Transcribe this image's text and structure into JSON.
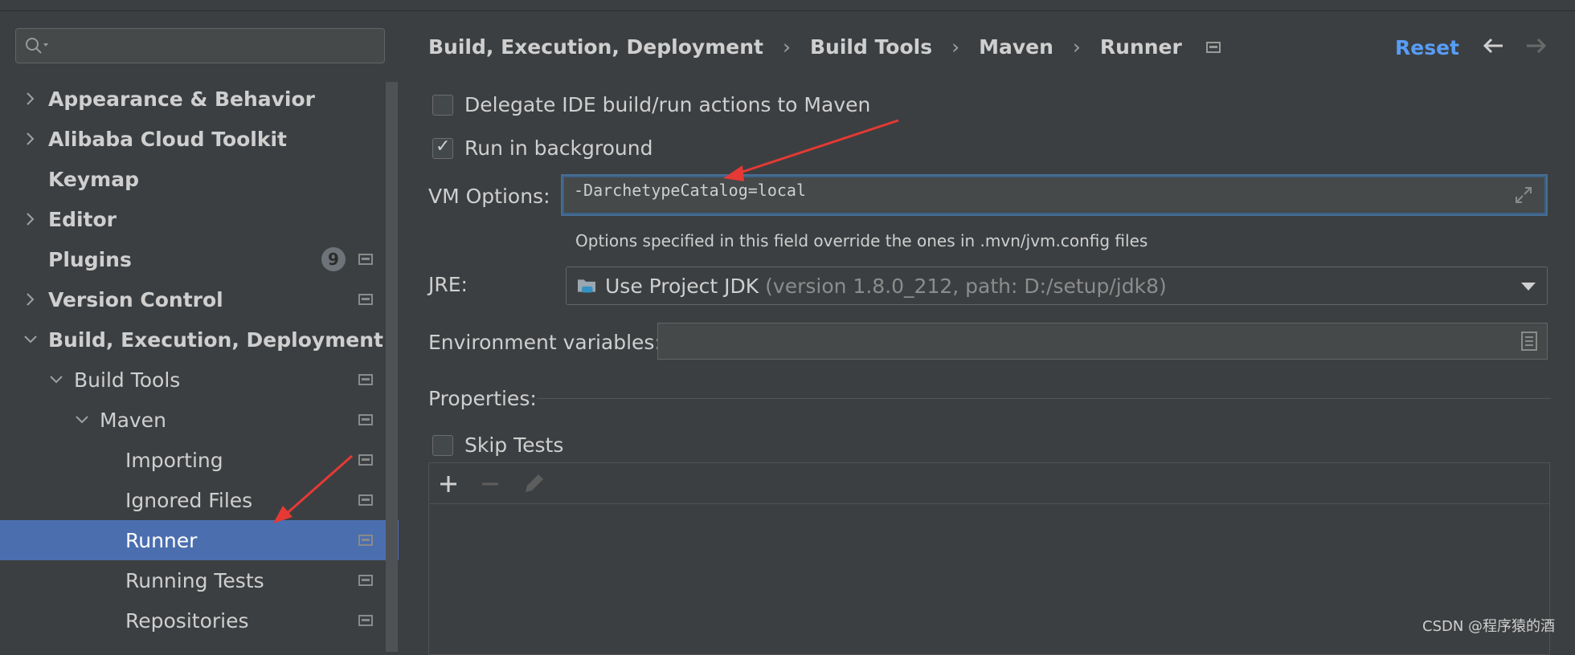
{
  "sidebar": {
    "search": {
      "placeholder": "",
      "value": ""
    },
    "items": [
      {
        "label": "Appearance & Behavior",
        "expand": "collapsed"
      },
      {
        "label": "Alibaba Cloud Toolkit",
        "expand": "collapsed"
      },
      {
        "label": "Keymap",
        "expand": "none"
      },
      {
        "label": "Editor",
        "expand": "collapsed"
      },
      {
        "label": "Plugins",
        "expand": "none",
        "badge": "9"
      },
      {
        "label": "Version Control",
        "expand": "collapsed"
      },
      {
        "label": "Build, Execution, Deployment",
        "expand": "expanded"
      },
      {
        "label": "Build Tools",
        "expand": "expanded"
      },
      {
        "label": "Maven",
        "expand": "expanded"
      },
      {
        "label": "Importing"
      },
      {
        "label": "Ignored Files"
      },
      {
        "label": "Runner",
        "selected": true
      },
      {
        "label": "Running Tests"
      },
      {
        "label": "Repositories"
      }
    ]
  },
  "breadcrumb": [
    "Build, Execution, Deployment",
    "Build Tools",
    "Maven",
    "Runner"
  ],
  "header": {
    "reset_label": "Reset",
    "back_icon": "arrow-left-icon",
    "forward_icon": "arrow-right-icon"
  },
  "runner": {
    "delegate_label": "Delegate IDE build/run actions to Maven",
    "delegate_checked": false,
    "background_label": "Run in background",
    "background_checked": true,
    "vm_options_label": "VM Options:",
    "vm_options_value": "-DarchetypeCatalog=local",
    "vm_options_hint": "Options specified in this field override the ones in .mvn/jvm.config files",
    "jre_label": "JRE:",
    "jre_value": "Use Project JDK",
    "jre_detail": "(version 1.8.0_212, path: D:/setup/jdk8)",
    "env_label": "Environment variables:",
    "env_value": "",
    "properties_label": "Properties:",
    "skip_tests_label": "Skip Tests",
    "skip_tests_checked": false
  },
  "colors": {
    "accent": "#589df6",
    "selection": "#4b6eaf",
    "annotation_arrow": "#e53935"
  },
  "watermark": "CSDN @程序猿的酒"
}
